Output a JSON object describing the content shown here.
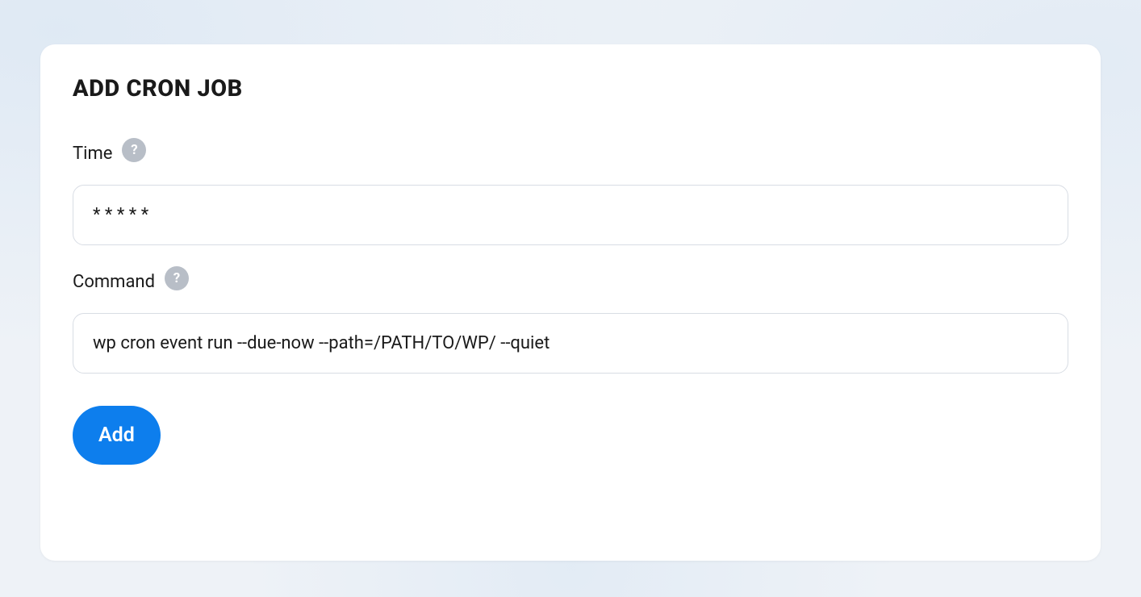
{
  "card": {
    "title": "ADD CRON JOB"
  },
  "form": {
    "time": {
      "label": "Time",
      "value": "* * * * *",
      "help": "?"
    },
    "command": {
      "label": "Command",
      "value": "wp cron event run --due-now --path=/PATH/TO/WP/ --quiet",
      "help": "?"
    },
    "submit": {
      "label": "Add"
    }
  }
}
